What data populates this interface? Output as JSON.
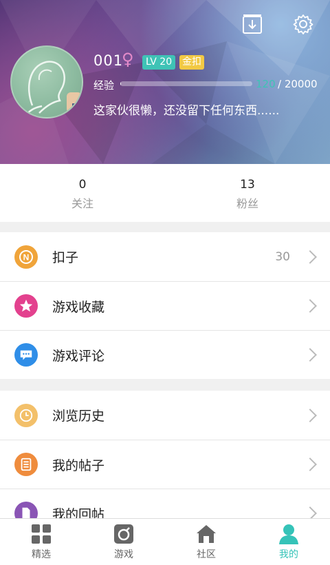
{
  "profile": {
    "username": "001",
    "gender_symbol": "♀",
    "level": "LV 20",
    "badge": "金扣",
    "exp_label": "经验",
    "exp_current": "120",
    "exp_total": "/ 20000",
    "exp_fraction": 0.006,
    "signature": "这家伙很懒，还没留下任何东西......"
  },
  "stats": [
    {
      "num": "0",
      "label": "关注"
    },
    {
      "num": "13",
      "label": "粉丝"
    }
  ],
  "menu1": [
    {
      "label": "扣子",
      "value": "30",
      "icon": "coin-icon",
      "color": "#f0a43a"
    },
    {
      "label": "游戏收藏",
      "value": "",
      "icon": "star-icon",
      "color": "#e3418e"
    },
    {
      "label": "游戏评论",
      "value": "",
      "icon": "comment-icon",
      "color": "#2f8ee8"
    }
  ],
  "menu2": [
    {
      "label": "浏览历史",
      "icon": "clock-icon",
      "color": "#f3c06a"
    },
    {
      "label": "我的帖子",
      "icon": "post-icon",
      "color": "#ef8c3d"
    },
    {
      "label": "我的回帖",
      "icon": "reply-icon",
      "color": "#8a55b5"
    }
  ],
  "tabs": [
    {
      "label": "精选"
    },
    {
      "label": "游戏"
    },
    {
      "label": "社区"
    },
    {
      "label": "我的"
    }
  ],
  "colors": {
    "accent": "#35c3b8",
    "tab_inactive": "#666666"
  }
}
